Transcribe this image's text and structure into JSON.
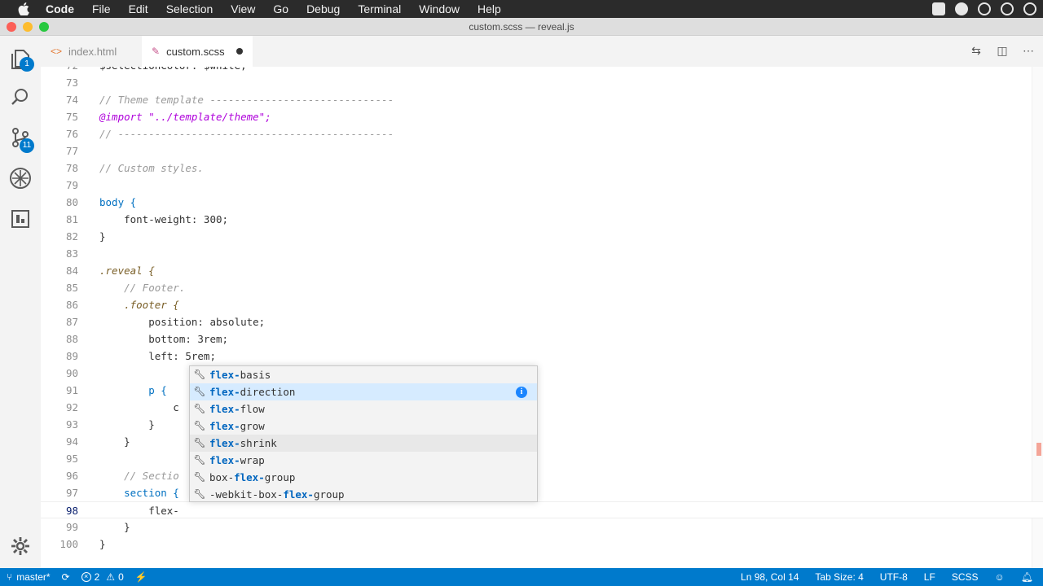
{
  "menubar": {
    "app": "Code",
    "items": [
      "File",
      "Edit",
      "Selection",
      "View",
      "Go",
      "Debug",
      "Terminal",
      "Window",
      "Help"
    ]
  },
  "window": {
    "title": "custom.scss — reveal.js"
  },
  "activity": {
    "explorer_badge": "1",
    "scm_badge": "11"
  },
  "tabs": [
    {
      "label": "index.html",
      "active": false
    },
    {
      "label": "custom.scss",
      "active": true,
      "dirty": true
    }
  ],
  "editor": {
    "lines": [
      {
        "n": "72",
        "text": "$selectionColor: $white;"
      },
      {
        "n": "73",
        "text": ""
      },
      {
        "n": "74",
        "text": "// Theme template ------------------------------"
      },
      {
        "n": "75",
        "text": "@import \"../template/theme\";"
      },
      {
        "n": "76",
        "text": "// ---------------------------------------------"
      },
      {
        "n": "77",
        "text": ""
      },
      {
        "n": "78",
        "text": "// Custom styles."
      },
      {
        "n": "79",
        "text": ""
      },
      {
        "n": "80",
        "text": "body {"
      },
      {
        "n": "81",
        "text": "    font-weight: 300;"
      },
      {
        "n": "82",
        "text": "}"
      },
      {
        "n": "83",
        "text": ""
      },
      {
        "n": "84",
        "text": ".reveal {"
      },
      {
        "n": "85",
        "text": "    // Footer."
      },
      {
        "n": "86",
        "text": "    .footer {"
      },
      {
        "n": "87",
        "text": "        position: absolute;"
      },
      {
        "n": "88",
        "text": "        bottom: 3rem;"
      },
      {
        "n": "89",
        "text": "        left: 5rem;"
      },
      {
        "n": "90",
        "text": ""
      },
      {
        "n": "91",
        "text": "        p {"
      },
      {
        "n": "92",
        "text": "            c"
      },
      {
        "n": "93",
        "text": "        }"
      },
      {
        "n": "94",
        "text": "    }"
      },
      {
        "n": "95",
        "text": ""
      },
      {
        "n": "96",
        "text": "    // Sectio"
      },
      {
        "n": "97",
        "text": "    section {"
      },
      {
        "n": "98",
        "text": "        flex-"
      },
      {
        "n": "99",
        "text": "    }"
      },
      {
        "n": "100",
        "text": "}"
      }
    ]
  },
  "suggestions": [
    {
      "match": "flex-",
      "rest": "basis"
    },
    {
      "match": "flex-",
      "rest": "direction"
    },
    {
      "match": "flex-",
      "rest": "flow"
    },
    {
      "match": "flex-",
      "rest": "grow"
    },
    {
      "match": "flex-",
      "rest": "shrink"
    },
    {
      "match": "flex-",
      "rest": "wrap"
    },
    {
      "pre": "box-",
      "match": "flex-",
      "rest": "group"
    },
    {
      "pre": "-webkit-box-",
      "match": "flex-",
      "rest": "group"
    }
  ],
  "suggest_info": "i",
  "statusbar": {
    "branch": "master*",
    "errors": "2",
    "warnings": "0",
    "position": "Ln 98, Col 14",
    "tabsize": "Tab Size: 4",
    "encoding": "UTF-8",
    "eol": "LF",
    "language": "SCSS"
  },
  "colors": {
    "statusbar": "#007acc",
    "suggest_focus": "#d6ebff",
    "match": "#0066bf"
  }
}
